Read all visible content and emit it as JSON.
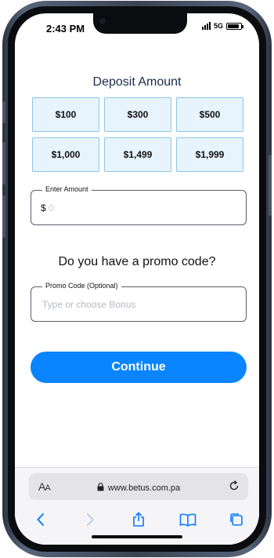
{
  "status_bar": {
    "time": "2:43 PM",
    "network": "5G",
    "battery_level": 0.9
  },
  "deposit": {
    "title": "Deposit Amount",
    "amounts": [
      "$100",
      "$300",
      "$500",
      "$1,000",
      "$1,499",
      "$1,999"
    ],
    "enter_amount": {
      "label": "Enter Amount",
      "currency_prefix": "$",
      "placeholder": "0",
      "value": ""
    }
  },
  "promo": {
    "heading": "Do you have a promo code?",
    "label": "Promo Code (Optional)",
    "placeholder": "Type or choose Bonus",
    "value": ""
  },
  "continue_button": {
    "label": "Continue"
  },
  "browser": {
    "text_size_label": "AA",
    "url": "www.betus.com.pa",
    "icons": [
      "lock-icon",
      "reload-icon",
      "back-icon",
      "forward-icon",
      "share-icon",
      "bookmarks-icon",
      "tabs-icon"
    ]
  },
  "colors": {
    "accent": "#0a84ff",
    "amount_button_bg": "#e8f4fd",
    "amount_button_border": "#8ec7e8",
    "title": "#1b2b4d"
  }
}
